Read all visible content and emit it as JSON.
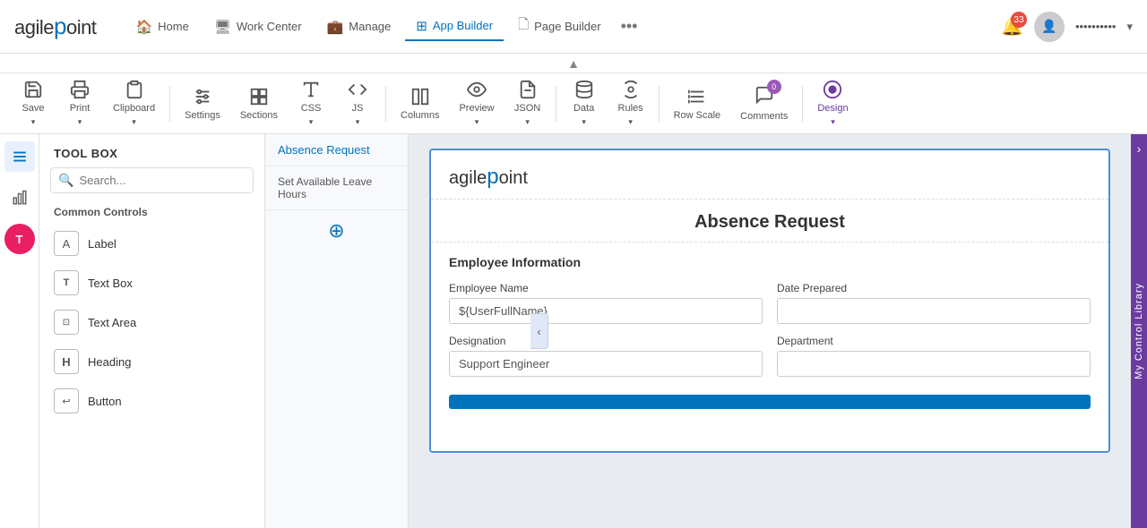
{
  "app": {
    "name": "agilepoint",
    "dot_char": "·"
  },
  "topnav": {
    "items": [
      {
        "id": "home",
        "label": "Home",
        "icon": "🏠",
        "active": false
      },
      {
        "id": "workcenter",
        "label": "Work Center",
        "icon": "🖥",
        "active": false
      },
      {
        "id": "manage",
        "label": "Manage",
        "icon": "💼",
        "active": false
      },
      {
        "id": "appbuilder",
        "label": "App Builder",
        "icon": "⊞",
        "active": true
      },
      {
        "id": "pagebuilder",
        "label": "Page Builder",
        "icon": "🗋",
        "active": false
      }
    ],
    "more_icon": "•••",
    "notification_count": "33",
    "user_name": "••••••••••"
  },
  "toolbar": {
    "items": [
      {
        "id": "save",
        "label": "Save",
        "has_arrow": true
      },
      {
        "id": "print",
        "label": "Print",
        "has_arrow": true
      },
      {
        "id": "clipboard",
        "label": "Clipboard",
        "has_arrow": true
      },
      {
        "id": "settings",
        "label": "Settings",
        "has_arrow": false
      },
      {
        "id": "sections",
        "label": "Sections",
        "has_arrow": false
      },
      {
        "id": "css",
        "label": "CSS",
        "has_arrow": true
      },
      {
        "id": "js",
        "label": "JS",
        "has_arrow": true
      },
      {
        "id": "columns",
        "label": "Columns",
        "has_arrow": false
      },
      {
        "id": "preview",
        "label": "Preview",
        "has_arrow": true
      },
      {
        "id": "json",
        "label": "JSON",
        "has_arrow": true
      },
      {
        "id": "data",
        "label": "Data",
        "has_arrow": true
      },
      {
        "id": "rules",
        "label": "Rules",
        "has_arrow": true
      },
      {
        "id": "rowscale",
        "label": "Row Scale",
        "has_arrow": false
      },
      {
        "id": "comments",
        "label": "Comments",
        "badge": "0",
        "has_arrow": false
      },
      {
        "id": "design",
        "label": "Design",
        "has_arrow": true,
        "active_blue": true
      }
    ]
  },
  "toolbox": {
    "title": "TOOL BOX",
    "search_placeholder": "Search...",
    "section_title": "Common Controls",
    "items": [
      {
        "id": "label",
        "label": "Label",
        "icon": "A"
      },
      {
        "id": "textbox",
        "label": "Text Box",
        "icon": "T"
      },
      {
        "id": "textarea",
        "label": "Text Area",
        "icon": "⊡"
      },
      {
        "id": "heading",
        "label": "Heading",
        "icon": "H"
      },
      {
        "id": "button",
        "label": "Button",
        "icon": "⊕"
      }
    ]
  },
  "middle_nav": {
    "items": [
      {
        "label": "Absence Request"
      },
      {
        "label": "Set Available Leave Hours"
      }
    ],
    "add_tooltip": "Add"
  },
  "form": {
    "logo_text": "agilepoint",
    "title": "Absence Request",
    "section_title": "Employee Information",
    "fields": [
      {
        "row": 1,
        "left": {
          "label": "Employee Name",
          "value": "${UserFullName}",
          "placeholder": ""
        },
        "right": {
          "label": "Date Prepared",
          "value": "",
          "placeholder": ""
        }
      },
      {
        "row": 2,
        "left": {
          "label": "Designation",
          "value": "Support Engineer",
          "placeholder": ""
        },
        "right": {
          "label": "Department",
          "value": "",
          "placeholder": ""
        }
      }
    ]
  },
  "right_panel": {
    "label": "My Control Library"
  },
  "collapse_btn": {
    "icon": "‹"
  }
}
